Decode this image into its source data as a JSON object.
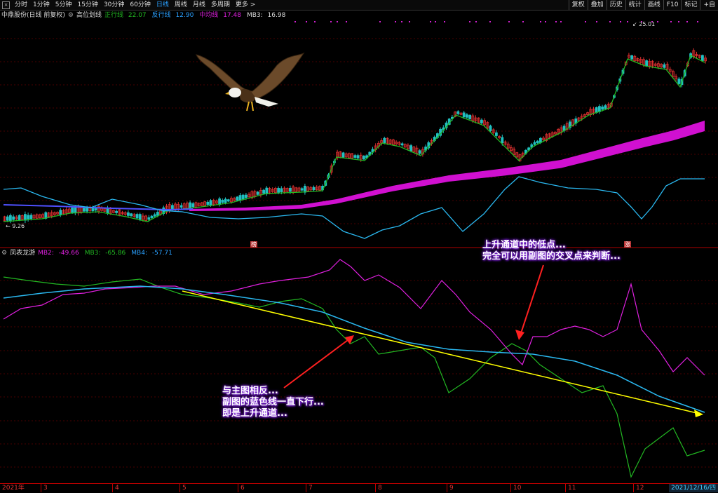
{
  "toolbar": {
    "left_items": [
      "分时",
      "1分钟",
      "5分钟",
      "15分钟",
      "30分钟",
      "60分钟",
      "日线",
      "周线",
      "月线",
      "多周期",
      "更多 >"
    ],
    "active_item": "日线",
    "right_items": [
      "复权",
      "叠加",
      "历史",
      "统计",
      "画线",
      "F10",
      "标记",
      "+自"
    ]
  },
  "main_legend": {
    "stock": "中鼎股份(日线 前复权)",
    "indicator": "高位划线",
    "items": [
      {
        "label": "正行线",
        "value": "22.07",
        "color": "#22b822"
      },
      {
        "label": "反行线",
        "value": "12.90",
        "color": "#2aa0ff"
      },
      {
        "label": "中均线",
        "value": "17.48",
        "color": "#e020e0"
      },
      {
        "label": "MB3:",
        "value": "16.98",
        "color": "#dddddd"
      }
    ]
  },
  "sub_legend": {
    "indicator": "凤表龙游",
    "items": [
      {
        "label": "MB2:",
        "value": "-49.66",
        "color": "#e020e0"
      },
      {
        "label": "MB3:",
        "value": "-65.86",
        "color": "#22b822"
      },
      {
        "label": "MB4:",
        "value": "-57.71",
        "color": "#2aa0ff"
      }
    ]
  },
  "price_marks": {
    "high": "25.01",
    "low": "9.26"
  },
  "tags": {
    "left": "榜",
    "right": "涨"
  },
  "annotations": {
    "top": [
      "上升通道中的低点...",
      "完全可以用副图的交叉点来判断..."
    ],
    "bottom": [
      "与主图相反...",
      "副图的蓝色线一直下行...",
      "即是上升通道..."
    ]
  },
  "axis": {
    "months": [
      "2021年",
      "3",
      "4",
      "5",
      "6",
      "7",
      "8",
      "9",
      "10",
      "11",
      "12"
    ],
    "current_date": "2021/12/16/四"
  },
  "colors": {
    "up": "#e03030",
    "down": "#20c0c0",
    "grid": "#5a0000",
    "yellow_line": "#ffff00",
    "arrow": "#ff2020"
  }
}
